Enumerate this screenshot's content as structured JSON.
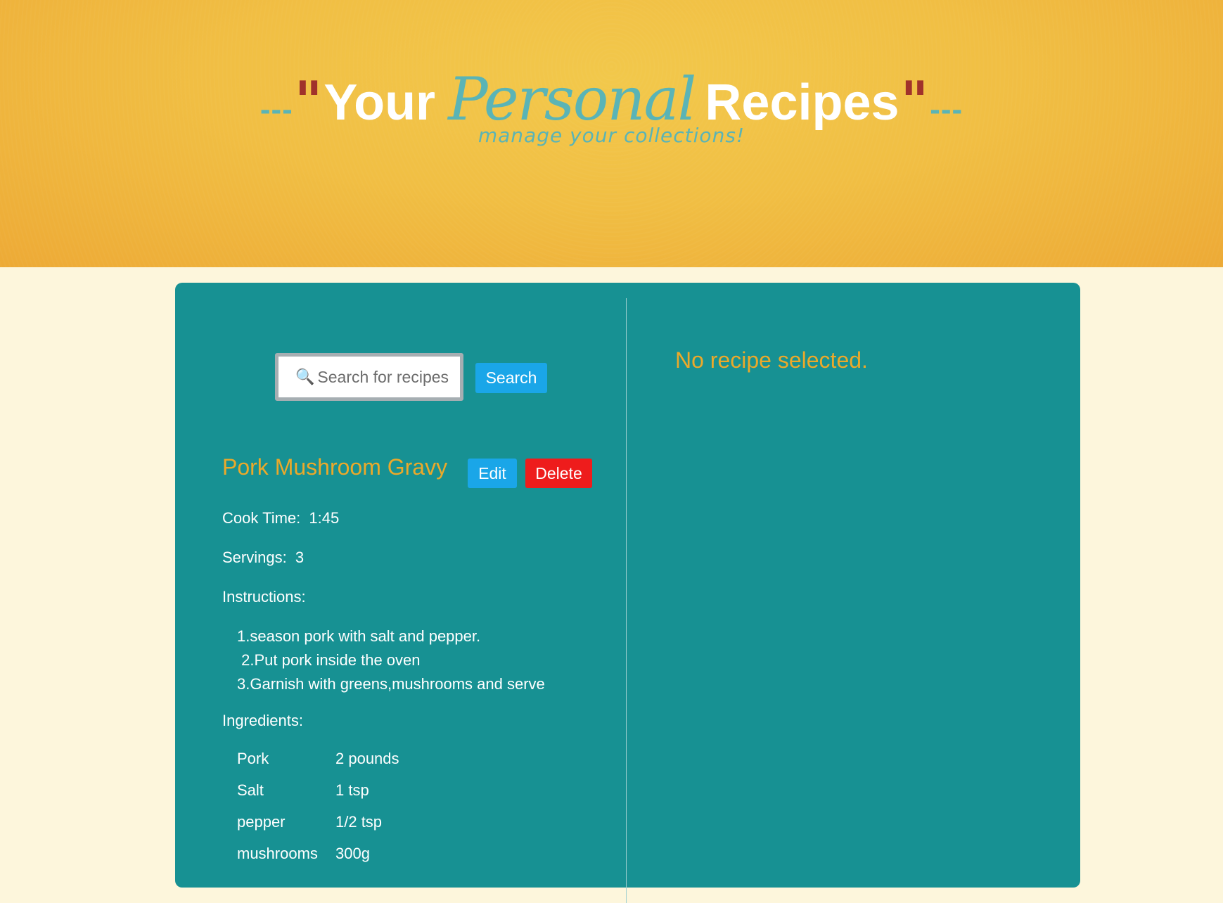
{
  "header": {
    "dashes_left": "---",
    "quote_open": "\"",
    "title_word_1": "Your",
    "title_word_script": "Personal",
    "title_word_2": "Recipes",
    "quote_close": "\"",
    "dashes_right": "---",
    "subtitle": "manage your collections!"
  },
  "search": {
    "placeholder": "Search for recipes",
    "value": "",
    "button_label": "Search"
  },
  "recipe": {
    "title": "Pork Mushroom Gravy",
    "edit_label": "Edit",
    "delete_label": "Delete",
    "cook_time_label": "Cook Time:",
    "cook_time_value": "1:45",
    "servings_label": "Servings:",
    "servings_value": "3",
    "instructions_label": "Instructions:",
    "instructions": [
      "1.season pork with salt and pepper.",
      " 2.Put pork inside the oven",
      "3.Garnish with greens,mushrooms and serve"
    ],
    "ingredients_label": "Ingredients:",
    "ingredients": [
      {
        "name": "Pork",
        "amount": "2 pounds"
      },
      {
        "name": "Salt",
        "amount": "1 tsp"
      },
      {
        "name": "pepper",
        "amount": "1/2 tsp"
      },
      {
        "name": "mushrooms",
        "amount": "300g"
      }
    ]
  },
  "detail": {
    "empty_message": "No recipe selected."
  },
  "colors": {
    "header_bg": "#f1bf44",
    "panel_bg": "#179193",
    "page_bg": "#fdf6dc",
    "accent_teal": "#5ab4b6",
    "accent_gold": "#eba92a",
    "button_blue": "#1aa6e8",
    "button_red": "#ee1c1c"
  },
  "icons": {
    "search": "magnifier-icon"
  }
}
